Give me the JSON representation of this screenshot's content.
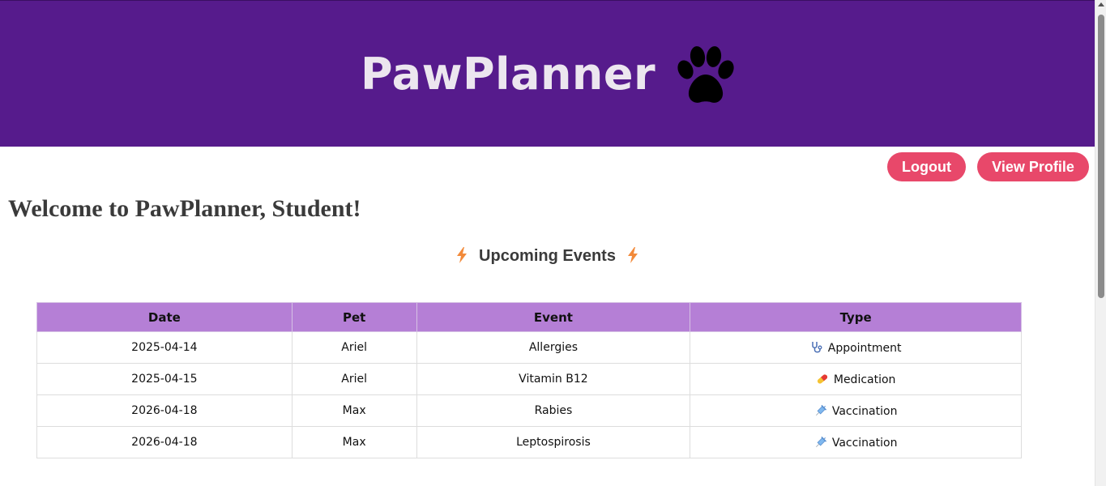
{
  "header": {
    "title": "PawPlanner",
    "logo_icon": "paw-icon"
  },
  "nav": {
    "logout_label": "Logout",
    "profile_label": "View Profile"
  },
  "main": {
    "welcome": "Welcome to PawPlanner, Student!",
    "events_title": "Upcoming Events",
    "events_icon": "lightning-icon"
  },
  "table": {
    "headers": [
      "Date",
      "Pet",
      "Event",
      "Type"
    ],
    "rows": [
      {
        "date": "2025-04-14",
        "pet": "Ariel",
        "event": "Allergies",
        "type": "Appointment",
        "icon": "stethoscope-icon"
      },
      {
        "date": "2025-04-15",
        "pet": "Ariel",
        "event": "Vitamin B12",
        "type": "Medication",
        "icon": "pill-icon"
      },
      {
        "date": "2026-04-18",
        "pet": "Max",
        "event": "Rabies",
        "type": "Vaccination",
        "icon": "syringe-icon"
      },
      {
        "date": "2026-04-18",
        "pet": "Max",
        "event": "Leptospirosis",
        "type": "Vaccination",
        "icon": "syringe-icon"
      }
    ]
  },
  "colors": {
    "header_bg": "#561b8c",
    "button_bg": "#e8486a",
    "table_header_bg": "#b57fd6"
  }
}
